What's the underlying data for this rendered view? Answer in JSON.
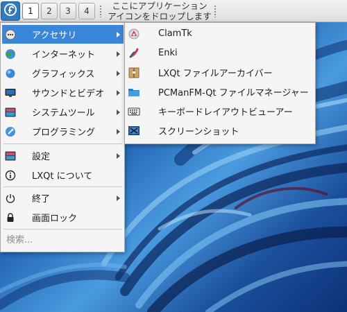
{
  "panel": {
    "start_icon": "fedora-icon",
    "desktops": [
      "1",
      "2",
      "3",
      "4"
    ],
    "active_desktop": "1",
    "quicklaunch_line1": "ここにアプリケーション",
    "quicklaunch_line2": "アイコンをドロップします"
  },
  "menu": {
    "items": [
      {
        "label": "アクセサリ",
        "icon": "accessories-icon",
        "submenu": true,
        "highlighted": true
      },
      {
        "label": "インターネット",
        "icon": "globe-icon",
        "submenu": true
      },
      {
        "label": "グラフィックス",
        "icon": "graphics-icon",
        "submenu": true
      },
      {
        "label": "サウンドとビデオ",
        "icon": "multimedia-icon",
        "submenu": true
      },
      {
        "label": "システムツール",
        "icon": "system-tools-icon",
        "submenu": true
      },
      {
        "label": "プログラミング",
        "icon": "programming-icon",
        "submenu": true
      },
      {
        "label": "設定",
        "icon": "settings-icon",
        "submenu": true
      },
      {
        "label": "LXQt について",
        "icon": "info-icon",
        "submenu": false
      },
      {
        "label": "終了",
        "icon": "power-icon",
        "submenu": true
      },
      {
        "label": "画面ロック",
        "icon": "lock-icon",
        "submenu": false
      }
    ],
    "search_placeholder": "検索..."
  },
  "submenu": {
    "items": [
      {
        "label": "ClamTk",
        "icon": "clamtk-icon"
      },
      {
        "label": "Enki",
        "icon": "enki-icon"
      },
      {
        "label": "LXQt ファイルアーカイバー",
        "icon": "archiver-icon"
      },
      {
        "label": "PCManFM-Qt ファイルマネージャー",
        "icon": "folder-icon"
      },
      {
        "label": "キーボードレイアウトビューアー",
        "icon": "keyboard-icon"
      },
      {
        "label": "スクリーンショット",
        "icon": "screenshot-icon"
      }
    ]
  },
  "colors": {
    "highlight": "#3a86d8",
    "panel": "#e8e8e8",
    "menu_bg": "#f5f5f5",
    "wallpaper_dark": "#0b2a66",
    "wallpaper_light": "#6fb4e8"
  }
}
